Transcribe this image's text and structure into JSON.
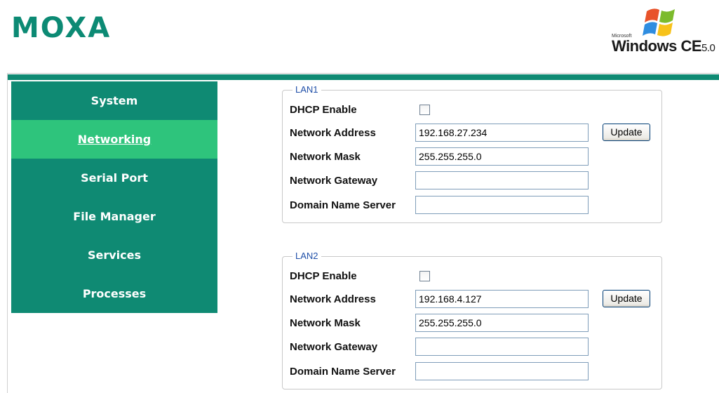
{
  "header": {
    "logo_text": "MOXA",
    "os_brand": {
      "maker": "Microsoft",
      "product": "Windows CE",
      "version": "5.0"
    }
  },
  "sidebar": {
    "items": [
      {
        "label": "System"
      },
      {
        "label": "Networking"
      },
      {
        "label": "Serial Port"
      },
      {
        "label": "File Manager"
      },
      {
        "label": "Services"
      },
      {
        "label": "Processes"
      }
    ],
    "active": "Networking"
  },
  "colors": {
    "brand_green": "#0f8a73",
    "active_green": "#2ec47c",
    "legend_blue": "#1f4fa8"
  },
  "lan1": {
    "legend": "LAN1",
    "dhcp_label": "DHCP Enable",
    "dhcp_checked": false,
    "address_label": "Network Address",
    "address_value": "192.168.27.234",
    "mask_label": "Network Mask",
    "mask_value": "255.255.255.0",
    "gateway_label": "Network Gateway",
    "gateway_value": "",
    "dns_label": "Domain Name Server",
    "dns_value": "",
    "update_label": "Update"
  },
  "lan2": {
    "legend": "LAN2",
    "dhcp_label": "DHCP Enable",
    "dhcp_checked": false,
    "address_label": "Network Address",
    "address_value": "192.168.4.127",
    "mask_label": "Network Mask",
    "mask_value": "255.255.255.0",
    "gateway_label": "Network Gateway",
    "gateway_value": "",
    "dns_label": "Domain Name Server",
    "dns_value": "",
    "update_label": "Update"
  }
}
